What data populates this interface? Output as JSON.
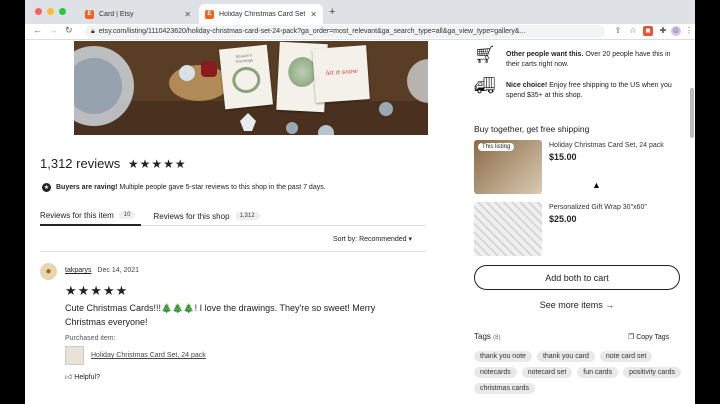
{
  "browser": {
    "tabs": [
      {
        "label": "Card | Etsy",
        "favicon": "E"
      },
      {
        "label": "Holiday Christmas Card Set 24",
        "favicon": "E"
      }
    ],
    "new_tab": "+",
    "url": "etsy.com/listing/1110423620/holiday-christmas-card-set-24-pack?ga_order=most_relevant&ga_search_type=all&ga_view_type=gallery&..."
  },
  "hero": {
    "card_text_1": "Season's Greetings",
    "card_text_2": "let it snow"
  },
  "reviews": {
    "count_title": "1,312 reviews",
    "stars": "★★★★★",
    "note_bold": "Buyers are raving!",
    "note_rest": "Multiple people gave 5-star reviews to this shop in the past 7 days.",
    "tabs": [
      {
        "label": "Reviews for this item",
        "count": "10"
      },
      {
        "label": "Reviews for this shop",
        "count": "1,312"
      }
    ],
    "sort_label": "Sort by: Recommended",
    "sort_caret": "▾",
    "item": {
      "user": "takparys",
      "date": "Dec 14, 2021",
      "stars": "★★★★★",
      "text": "Cute Christmas Cards!!!🎄🎄🎄! I love the drawings. They're so sweet! Merry Christmas everyone!",
      "purchased_label": "Purchased item:",
      "purchased_item": "Holiday Christmas Card Set, 24 pack",
      "helpful": "Helpful?"
    }
  },
  "side": {
    "info1_bold": "Other people want this.",
    "info1_rest": "Over 20 people have this in their carts right now.",
    "info2_bold": "Nice choice!",
    "info2_rest": "Enjoy free shipping to the US when you spend $35+ at this shop.",
    "buy_together": "Buy together, get free shipping",
    "products": [
      {
        "tag": "This listing",
        "name": "Holiday Christmas Card Set, 24 pack",
        "price": "$15.00"
      },
      {
        "name": "Personalized Gift Wrap 30\"x60\"",
        "price": "$25.00"
      }
    ],
    "add_both": "Add both to cart",
    "see_more": "See more items",
    "see_more_arrow": "→",
    "tags_title": "Tags",
    "tags_count": "(8)",
    "copy_tags": "Copy Tags",
    "tags": [
      "thank you note",
      "thank you card",
      "note card set",
      "notecards",
      "notecard set",
      "fun cards",
      "positivity cards",
      "christmas cards"
    ]
  },
  "colors": {
    "etsy_orange": "#f1641e",
    "text": "#222222"
  }
}
